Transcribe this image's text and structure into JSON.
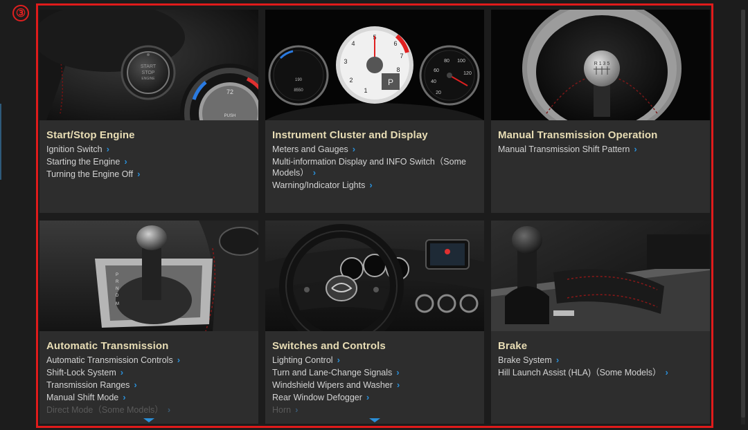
{
  "marker": "③",
  "cards": [
    {
      "title": "Start/Stop Engine",
      "links": [
        "Ignition Switch",
        "Starting the Engine",
        "Turning the Engine Off"
      ],
      "photo_text": {
        "button": "START\nSTOP\nENGINE",
        "knob_value": "72",
        "knob_label": "PUSH"
      }
    },
    {
      "title": "Instrument Cluster and Display",
      "links": [
        "Meters and Gauges",
        "Multi-information Display and INFO Switch（Some Models）",
        "Warning/Indicator Lights"
      ],
      "photo_text": {
        "gear": "P",
        "odo1": "190",
        "odo2": "8550"
      }
    },
    {
      "title": "Manual Transmission Operation",
      "links": [
        "Manual Transmission Shift Pattern"
      ]
    },
    {
      "title": "Automatic Transmission",
      "links": [
        "Automatic Transmission Controls",
        "Shift-Lock System",
        "Transmission Ranges",
        "Manual Shift Mode",
        "Direct Mode（Some Models）"
      ],
      "more": true
    },
    {
      "title": "Switches and Controls",
      "links": [
        "Lighting Control",
        "Turn and Lane-Change Signals",
        "Windshield Wipers and Washer",
        "Rear Window Defogger",
        "Horn"
      ],
      "more": true
    },
    {
      "title": "Brake",
      "links": [
        "Brake System",
        "Hill Launch Assist (HLA)（Some Models）"
      ]
    }
  ],
  "colors": {
    "accent": "#2a8fd8",
    "title": "#e8ddb5",
    "frame": "#e01b1b",
    "card": "#2d2d2d"
  },
  "icons": {
    "link_arrow": "chevron-right-icon",
    "expand": "chevron-down-icon"
  }
}
